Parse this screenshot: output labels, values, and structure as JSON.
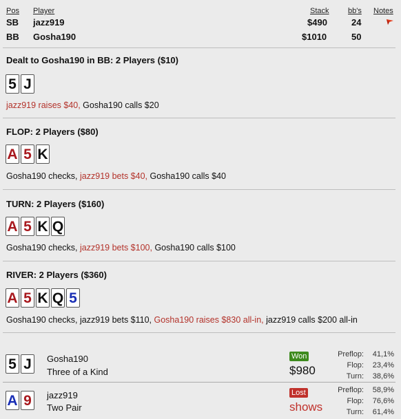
{
  "header": {
    "pos_label": "Pos",
    "player_label": "Player",
    "stack_label": "Stack",
    "bbs_label": "bb's",
    "notes_label": "Notes"
  },
  "players": [
    {
      "pos": "SB",
      "name": "jazz919",
      "stack": "$490",
      "bbs": "24"
    },
    {
      "pos": "BB",
      "name": "Gosha190",
      "stack": "$1010",
      "bbs": "50"
    }
  ],
  "notes_icon": "flag-icon",
  "preflop": {
    "title": "Dealt to Gosha190 in BB: 2 Players ($10)",
    "cards": [
      "5",
      "J"
    ],
    "action_hl": "jazz919 raises $40,",
    "action_rest": " Gosha190 calls $20"
  },
  "flop": {
    "title": "FLOP: 2 Players ($80)",
    "cards": [
      "A",
      "5",
      "K"
    ],
    "action_a": "Gosha190 checks, ",
    "action_hl": "jazz919 bets $40,",
    "action_b": " Gosha190 calls $40"
  },
  "turn": {
    "title": "TURN: 2 Players ($160)",
    "cards": [
      "A",
      "5",
      "K",
      "Q"
    ],
    "action_a": "Gosha190 checks, ",
    "action_hl": "jazz919 bets $100,",
    "action_b": " Gosha190 calls $100"
  },
  "river": {
    "title": "RIVER: 2 Players ($360)",
    "cards": [
      "A",
      "5",
      "K",
      "Q",
      "5"
    ],
    "action_a": "Gosha190 checks, jazz919 bets $110, ",
    "action_hl": "Gosha190 raises $830 all-in,",
    "action_b": " jazz919 calls $200 all-in"
  },
  "results": [
    {
      "cards": [
        "5",
        "J"
      ],
      "name": "Gosha190",
      "hand": "Three of a Kind",
      "status": "Won",
      "amount": "$980",
      "eq_labels": [
        "Preflop:",
        "Flop:",
        "Turn:"
      ],
      "eq_values": [
        "41,1%",
        "23,4%",
        "38,6%"
      ]
    },
    {
      "cards": [
        "A",
        "9"
      ],
      "name": "jazz919",
      "hand": "Two Pair",
      "status": "Lost",
      "amount": "shows",
      "eq_labels": [
        "Preflop:",
        "Flop:",
        "Turn:"
      ],
      "eq_values": [
        "58,9%",
        "76,6%",
        "61,4%"
      ]
    }
  ],
  "colors": {
    "accent_red": "#b3322a",
    "won_green": "#3d8a1d",
    "lost_red": "#c0312b",
    "card_red": "#a8191e",
    "card_blue": "#1a2fb5"
  }
}
